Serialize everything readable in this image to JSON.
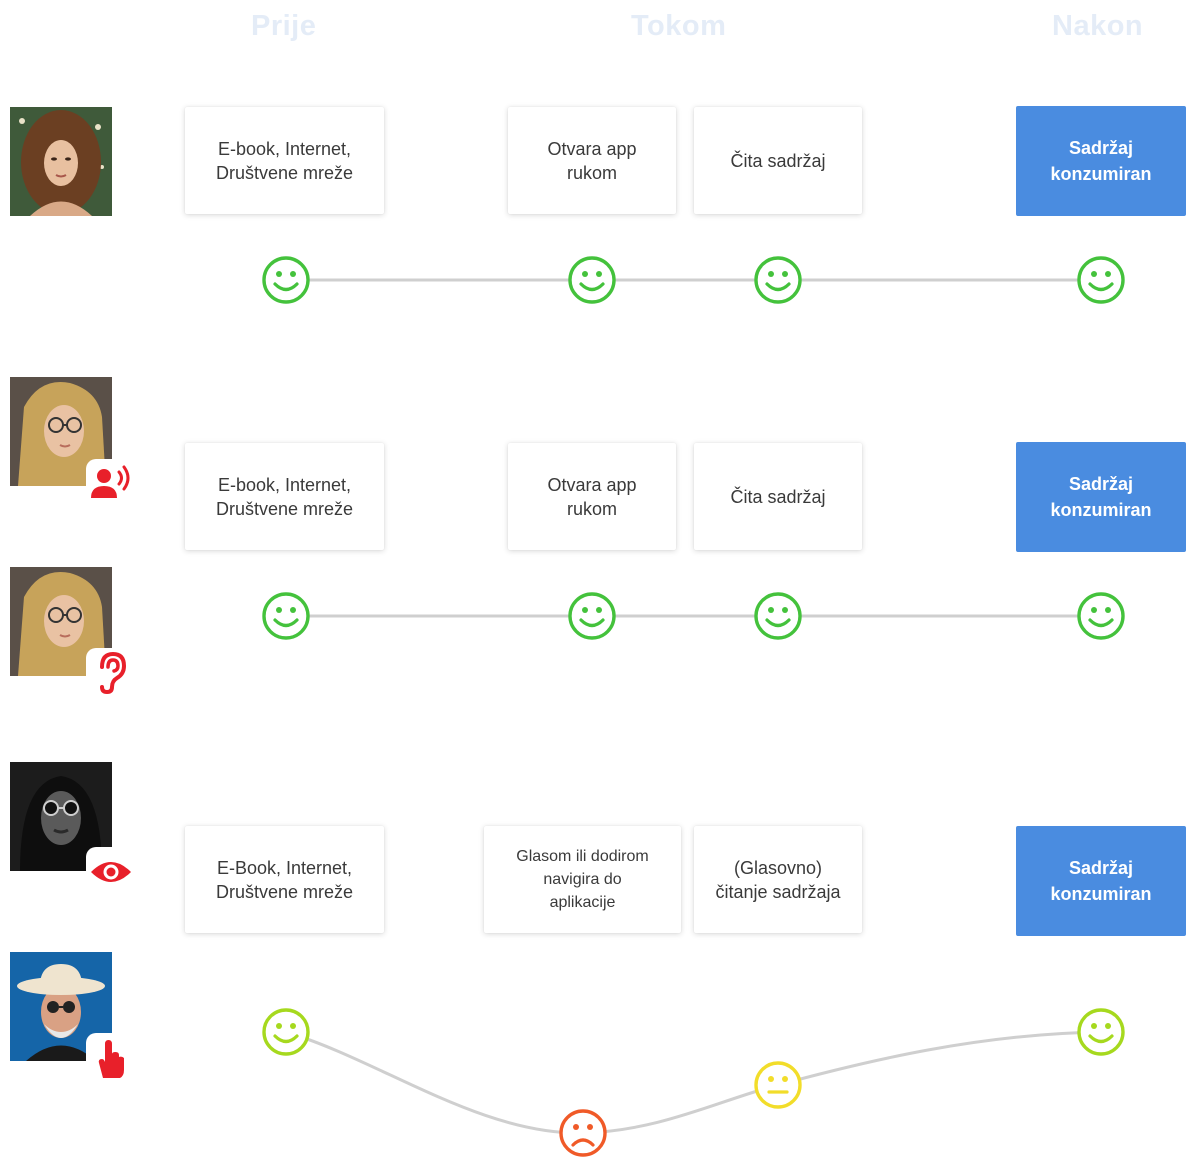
{
  "phases": {
    "before": "Prije",
    "during": "Tokom",
    "after": "Nakon"
  },
  "colors": {
    "happy": "#44c23c",
    "happy_lime": "#a6d91e",
    "neutral": "#f2dd2a",
    "sad": "#f05a28",
    "accent": "#4a8ce0",
    "badge_red": "#e8202a",
    "phase_text": "#e4ecf7"
  },
  "rows": [
    {
      "persona": "curly-hair-woman",
      "cards": [
        "E-book, Internet,\nDruštvene mreže",
        "Otvara app\nrukom",
        "Čita sadržaj"
      ],
      "final": "Sadržaj\nkonzumiran",
      "moods": [
        "happy",
        "happy",
        "happy",
        "happy"
      ]
    },
    {
      "persona": "woman-with-glasses",
      "badges": [
        "speaking-person-icon",
        "ear-icon"
      ],
      "cards": [
        "E-book, Internet,\nDruštvene mreže",
        "Otvara app\nrukom",
        "Čita sadržaj"
      ],
      "final": "Sadržaj\nkonzumiran",
      "moods": [
        "happy",
        "happy",
        "happy",
        "happy"
      ]
    },
    {
      "persona": "man-with-sunglasses",
      "badges": [
        "eye-icon",
        "touch-hand-icon"
      ],
      "cards": [
        "E-Book, Internet,\nDruštvene mreže",
        "Glasom ili dodirom\nnavigira do\naplikacije",
        "(Glasovno)\nčitanje sadržaja"
      ],
      "final": "Sadržaj\nkonzumiran",
      "moods": [
        "happy",
        "sad",
        "neutral",
        "happy"
      ]
    }
  ]
}
